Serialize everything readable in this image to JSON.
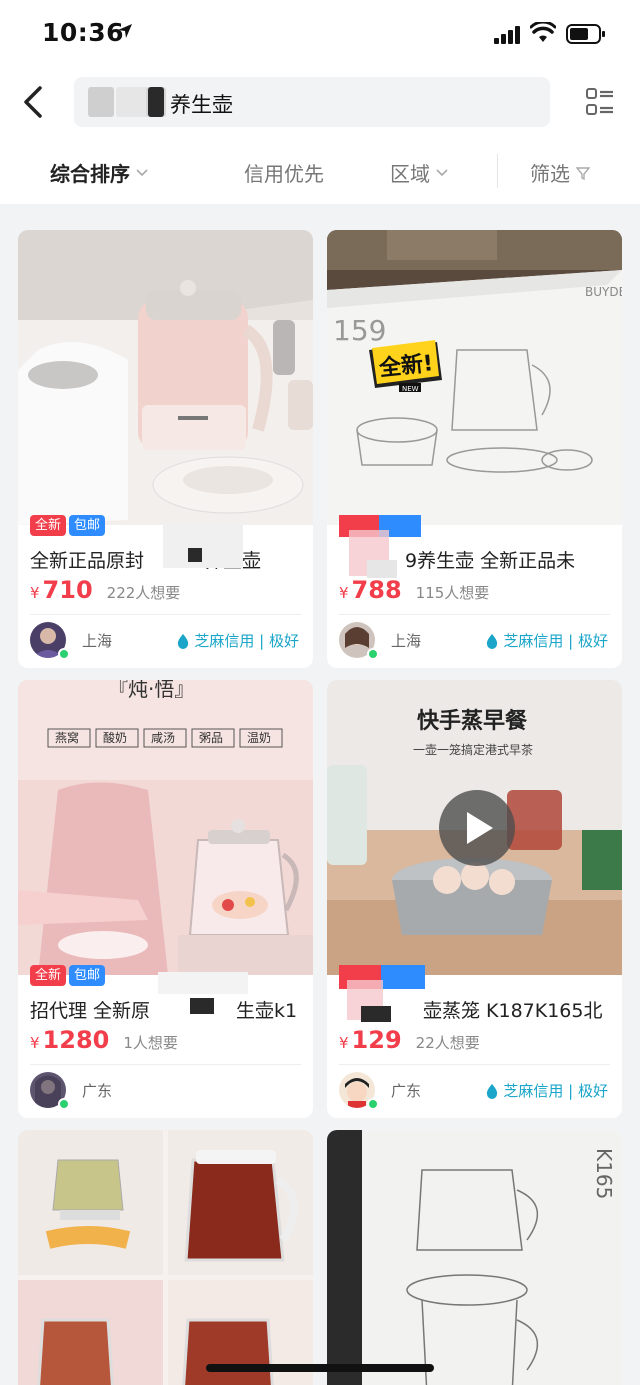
{
  "status_bar": {
    "time": "10:36"
  },
  "search": {
    "query": "养生壶"
  },
  "filters": [
    {
      "label": "综合排序",
      "active": true
    },
    {
      "label": "信用优先",
      "active": false
    },
    {
      "label": "区域",
      "active": false
    },
    {
      "label": "筛选",
      "active": false
    }
  ],
  "products": [
    {
      "title_left": "全新正品原封",
      "title_right": "养生壶",
      "currency": "¥",
      "price": "710",
      "wants": "222人想要",
      "city": "上海",
      "credit": "芝麻信用 | 极好",
      "badge_new": "全新",
      "badge_ship": "包邮"
    },
    {
      "title": "9养生壶 全新正品未",
      "currency": "¥",
      "price": "788",
      "wants": "115人想要",
      "city": "上海",
      "credit": "芝麻信用 | 极好",
      "overlay_text": "全新!",
      "overlay_sub": "NEW",
      "box_number": "159",
      "box_brand": "BUYDE"
    },
    {
      "title_left": "招代理 全新原",
      "title_right": "生壶k1",
      "currency": "¥",
      "price": "1280",
      "wants": "1人想要",
      "city": "广东",
      "badge_new": "全新",
      "badge_ship": "包邮",
      "top_text": "『炖·悟』",
      "tags": [
        "燕窝",
        "酸奶",
        "咸汤",
        "粥品",
        "温奶"
      ]
    },
    {
      "title": "壶蒸笼 K187K165北",
      "currency": "¥",
      "price": "129",
      "wants": "22人想要",
      "city": "广东",
      "credit": "芝麻信用 | 极好",
      "headline": "快手蒸早餐",
      "subline": "一壶一笼搞定港式早茶"
    },
    {
      "note": "partial card"
    },
    {
      "box_text": "K165"
    }
  ]
}
